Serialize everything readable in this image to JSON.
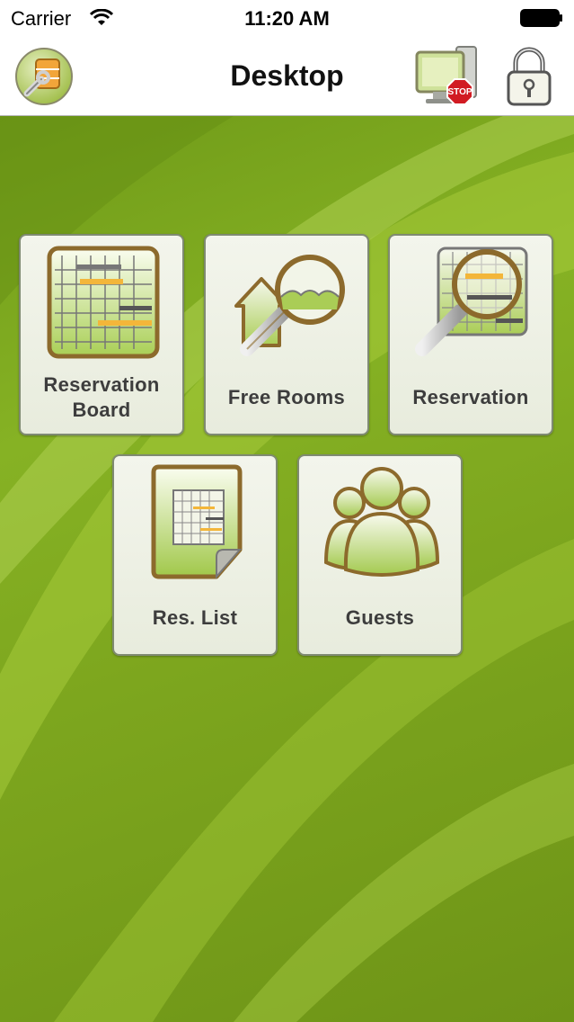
{
  "status_bar": {
    "carrier": "Carrier",
    "time": "11:20 AM"
  },
  "nav": {
    "title": "Desktop"
  },
  "icons": {
    "settings": "settings-wrench-icon",
    "stop": "stop-workstation-icon",
    "lock": "padlock-icon"
  },
  "tiles": [
    {
      "label": "Reservation Board",
      "icon": "reservation-board-icon"
    },
    {
      "label": "Free Rooms",
      "icon": "free-rooms-icon"
    },
    {
      "label": "Reservation",
      "icon": "reservation-search-icon"
    },
    {
      "label": "Res. List",
      "icon": "res-list-icon"
    },
    {
      "label": "Guests",
      "icon": "guests-icon"
    }
  ],
  "colors": {
    "background_green": "#7da61e",
    "accent_orange": "#f3b63a",
    "tile_border": "#7f8a72"
  }
}
